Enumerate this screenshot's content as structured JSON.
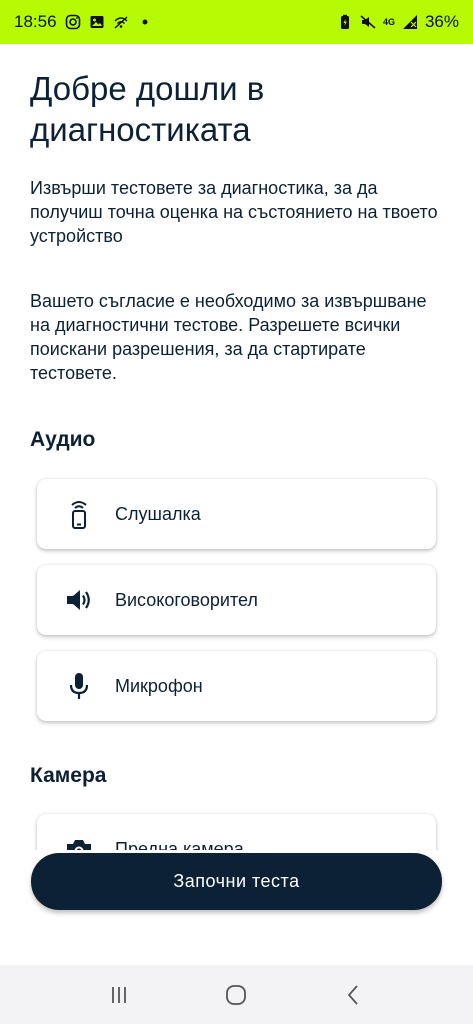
{
  "status_bar": {
    "time": "18:56",
    "network": "4G",
    "battery": "36%",
    "background_color": "#b6fb04"
  },
  "header": {
    "title": "Добре дошли в диагностиката"
  },
  "intro_text": "Извърши тестовете за диагностика, за да получиш точна оценка на състоянието на твоето устройство",
  "consent_text": "Вашето съгласие е необходимо за извършване на диагностични тестове. Разрешете всички поискани разрешения, за да стартирате тестовете.",
  "sections": {
    "audio": {
      "title": "Аудио",
      "items": [
        {
          "label": "Слушалка",
          "icon": "earpiece-icon"
        },
        {
          "label": "Високоговорител",
          "icon": "speaker-icon"
        },
        {
          "label": "Микрофон",
          "icon": "microphone-icon"
        }
      ]
    },
    "camera": {
      "title": "Камера",
      "items": [
        {
          "label": "Предна камера",
          "icon": "camera-icon"
        }
      ]
    }
  },
  "start_button": {
    "label": "Започни теста"
  },
  "colors": {
    "primary": "#0d2136",
    "nav_background": "#f3f3f6"
  }
}
